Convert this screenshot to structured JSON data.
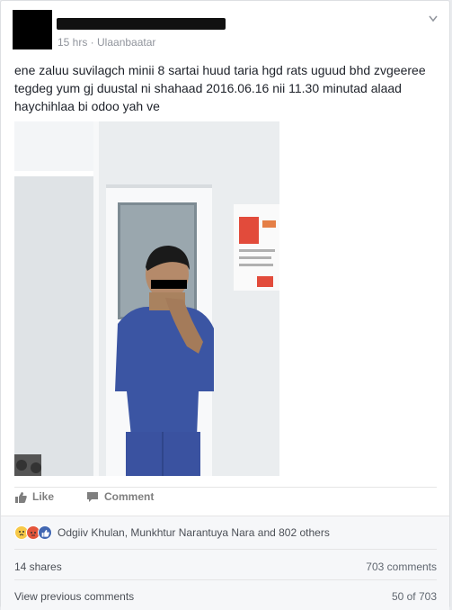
{
  "post": {
    "meta": "15 hrs · Ulaanbaatar",
    "text": "ene zaluu suvilagch minii 8 sartai huud taria hgd rats uguud bhd zvgeeree tegdeg yum gj duustal ni shahaad 2016.06.16 nii 11.30 minutad alaad haychihlaa bi odoo yah ve"
  },
  "actions": {
    "like_label": "Like",
    "comment_label": "Comment"
  },
  "reactions": {
    "icons": [
      "sad-icon",
      "angry-icon",
      "like-icon"
    ],
    "text": "Odgiiv Khulan, Munkhtur Narantuya Nara and 802 others"
  },
  "stats": {
    "shares": "14 shares",
    "comments": "703 comments"
  },
  "comments_nav": {
    "view_previous": "View previous comments",
    "count": "50 of 703"
  },
  "colors": {
    "brand_blue": "#4267b2",
    "meta_gray": "#90949c",
    "background": "#e9ebee"
  }
}
